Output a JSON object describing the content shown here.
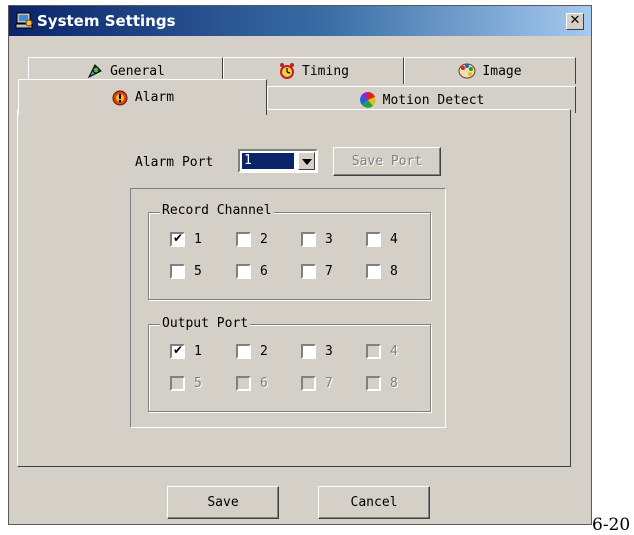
{
  "window": {
    "title": "System Settings",
    "close_glyph": "✕"
  },
  "tabs": {
    "row_back": [
      {
        "label": "General",
        "icon": "general-icon"
      },
      {
        "label": "Timing",
        "icon": "alarm-clock-icon"
      },
      {
        "label": "Image",
        "icon": "palette-icon"
      }
    ],
    "row_front": [
      {
        "label": "Alarm",
        "icon": "alarm-icon",
        "selected": true
      },
      {
        "label": "Motion Detect",
        "icon": "color-wheel-icon"
      }
    ]
  },
  "alarm_port": {
    "label": "Alarm Port",
    "selected_value": "1",
    "save_label": "Save Port"
  },
  "record_channel": {
    "legend": "Record Channel",
    "items": [
      {
        "label": "1",
        "checked": true,
        "enabled": true
      },
      {
        "label": "2",
        "checked": false,
        "enabled": true
      },
      {
        "label": "3",
        "checked": false,
        "enabled": true
      },
      {
        "label": "4",
        "checked": false,
        "enabled": true
      },
      {
        "label": "5",
        "checked": false,
        "enabled": true
      },
      {
        "label": "6",
        "checked": false,
        "enabled": true
      },
      {
        "label": "7",
        "checked": false,
        "enabled": true
      },
      {
        "label": "8",
        "checked": false,
        "enabled": true
      }
    ]
  },
  "output_port": {
    "legend": "Output Port",
    "items": [
      {
        "label": "1",
        "checked": true,
        "enabled": true
      },
      {
        "label": "2",
        "checked": false,
        "enabled": true
      },
      {
        "label": "3",
        "checked": false,
        "enabled": true
      },
      {
        "label": "4",
        "checked": false,
        "enabled": false
      },
      {
        "label": "5",
        "checked": false,
        "enabled": false
      },
      {
        "label": "6",
        "checked": false,
        "enabled": false
      },
      {
        "label": "7",
        "checked": false,
        "enabled": false
      },
      {
        "label": "8",
        "checked": false,
        "enabled": false
      }
    ]
  },
  "footer": {
    "save_label": "Save",
    "cancel_label": "Cancel"
  },
  "caption_fragment": "6-20",
  "colors": {
    "title_bar_start": "#0a246a",
    "title_bar_end": "#a6caf0",
    "dialog_face": "#d4d0c8",
    "selection": "#0a246a"
  }
}
